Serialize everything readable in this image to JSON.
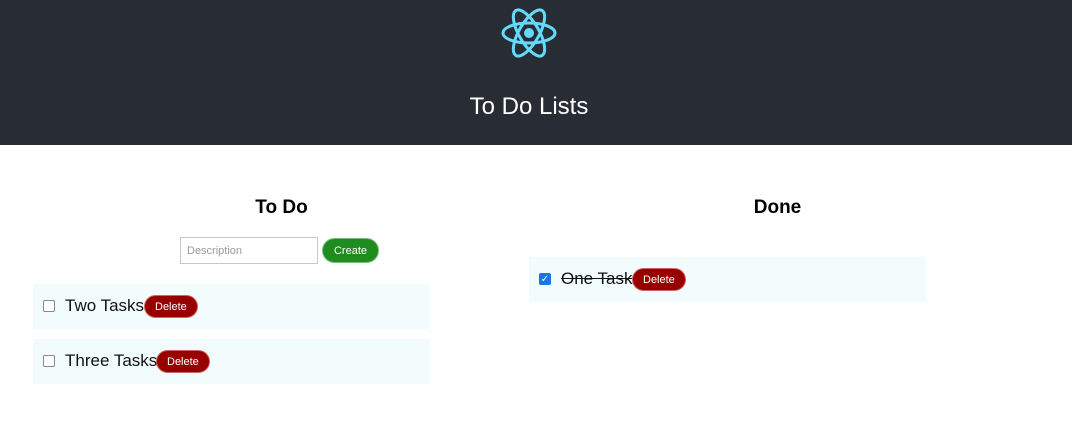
{
  "header": {
    "logo_icon": "react-atom-icon",
    "title": "To Do Lists",
    "background": "#282c34",
    "logo_color": "#61dafb"
  },
  "todo": {
    "title": "To Do",
    "input_placeholder": "Description",
    "input_value": "",
    "create_label": "Create",
    "items": [
      {
        "label": "Two Tasks",
        "checked": false,
        "delete_label": "Delete"
      },
      {
        "label": "Three Tasks",
        "checked": false,
        "delete_label": "Delete"
      }
    ]
  },
  "done": {
    "title": "Done",
    "items": [
      {
        "label": "One Task",
        "checked": true,
        "delete_label": "Delete"
      }
    ]
  },
  "colors": {
    "create_button": "#1f8c1f",
    "delete_button": "#980000",
    "row_background": "#f3fcfd"
  }
}
